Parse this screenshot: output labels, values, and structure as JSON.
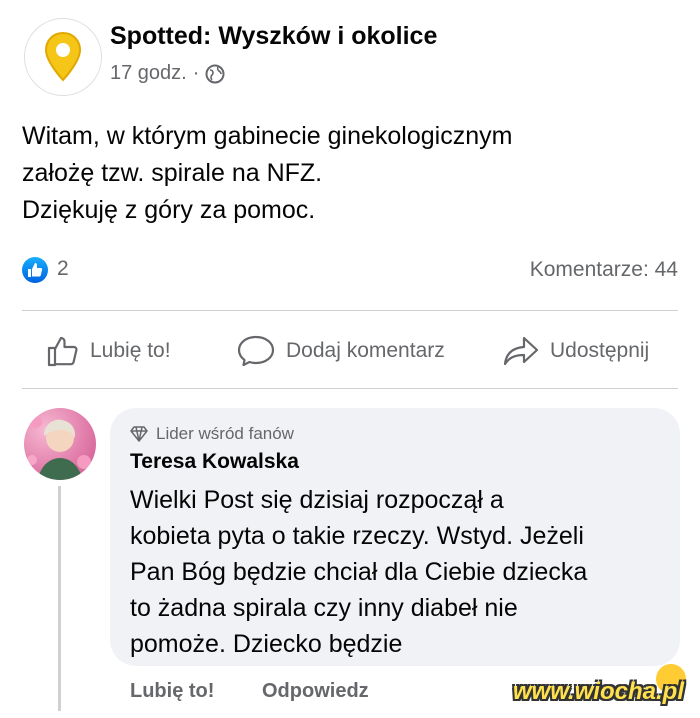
{
  "post": {
    "page_name": "Spotted: Wyszków i okolice",
    "time": "17 godz.",
    "separator": "·",
    "privacy_icon": "globe-icon",
    "lines": [
      "Witam, w którym gabinecie ginekologicznym",
      "założę tzw. spirale na NFZ.",
      "Dziękuję z góry za pomoc."
    ],
    "reaction_count": "2",
    "comments_label": "Komentarze: 44"
  },
  "actions": {
    "like": "Lubię to!",
    "comment": "Dodaj komentarz",
    "share": "Udostępnij"
  },
  "comment": {
    "badge": "Lider wśród fanów",
    "author": "Teresa Kowalska",
    "lines": [
      "Wielki Post się dzisiaj rozpoczął a",
      "kobieta pyta o takie rzeczy. Wstyd. Jeżeli",
      "Pan Bóg będzie chciał dla Ciebie dziecka",
      "to żadna spirala  czy inny diabeł nie",
      "pomoże. Dziecko będzie"
    ],
    "like": "Lubię to!",
    "reply": "Odpowiedz"
  },
  "watermark": "www.wiocha.pl",
  "colors": {
    "brand_blue": "#1877f2",
    "pin_yellow": "#f5c518",
    "secondary_text": "#65676b",
    "bubble_bg": "#f0f2f5"
  }
}
